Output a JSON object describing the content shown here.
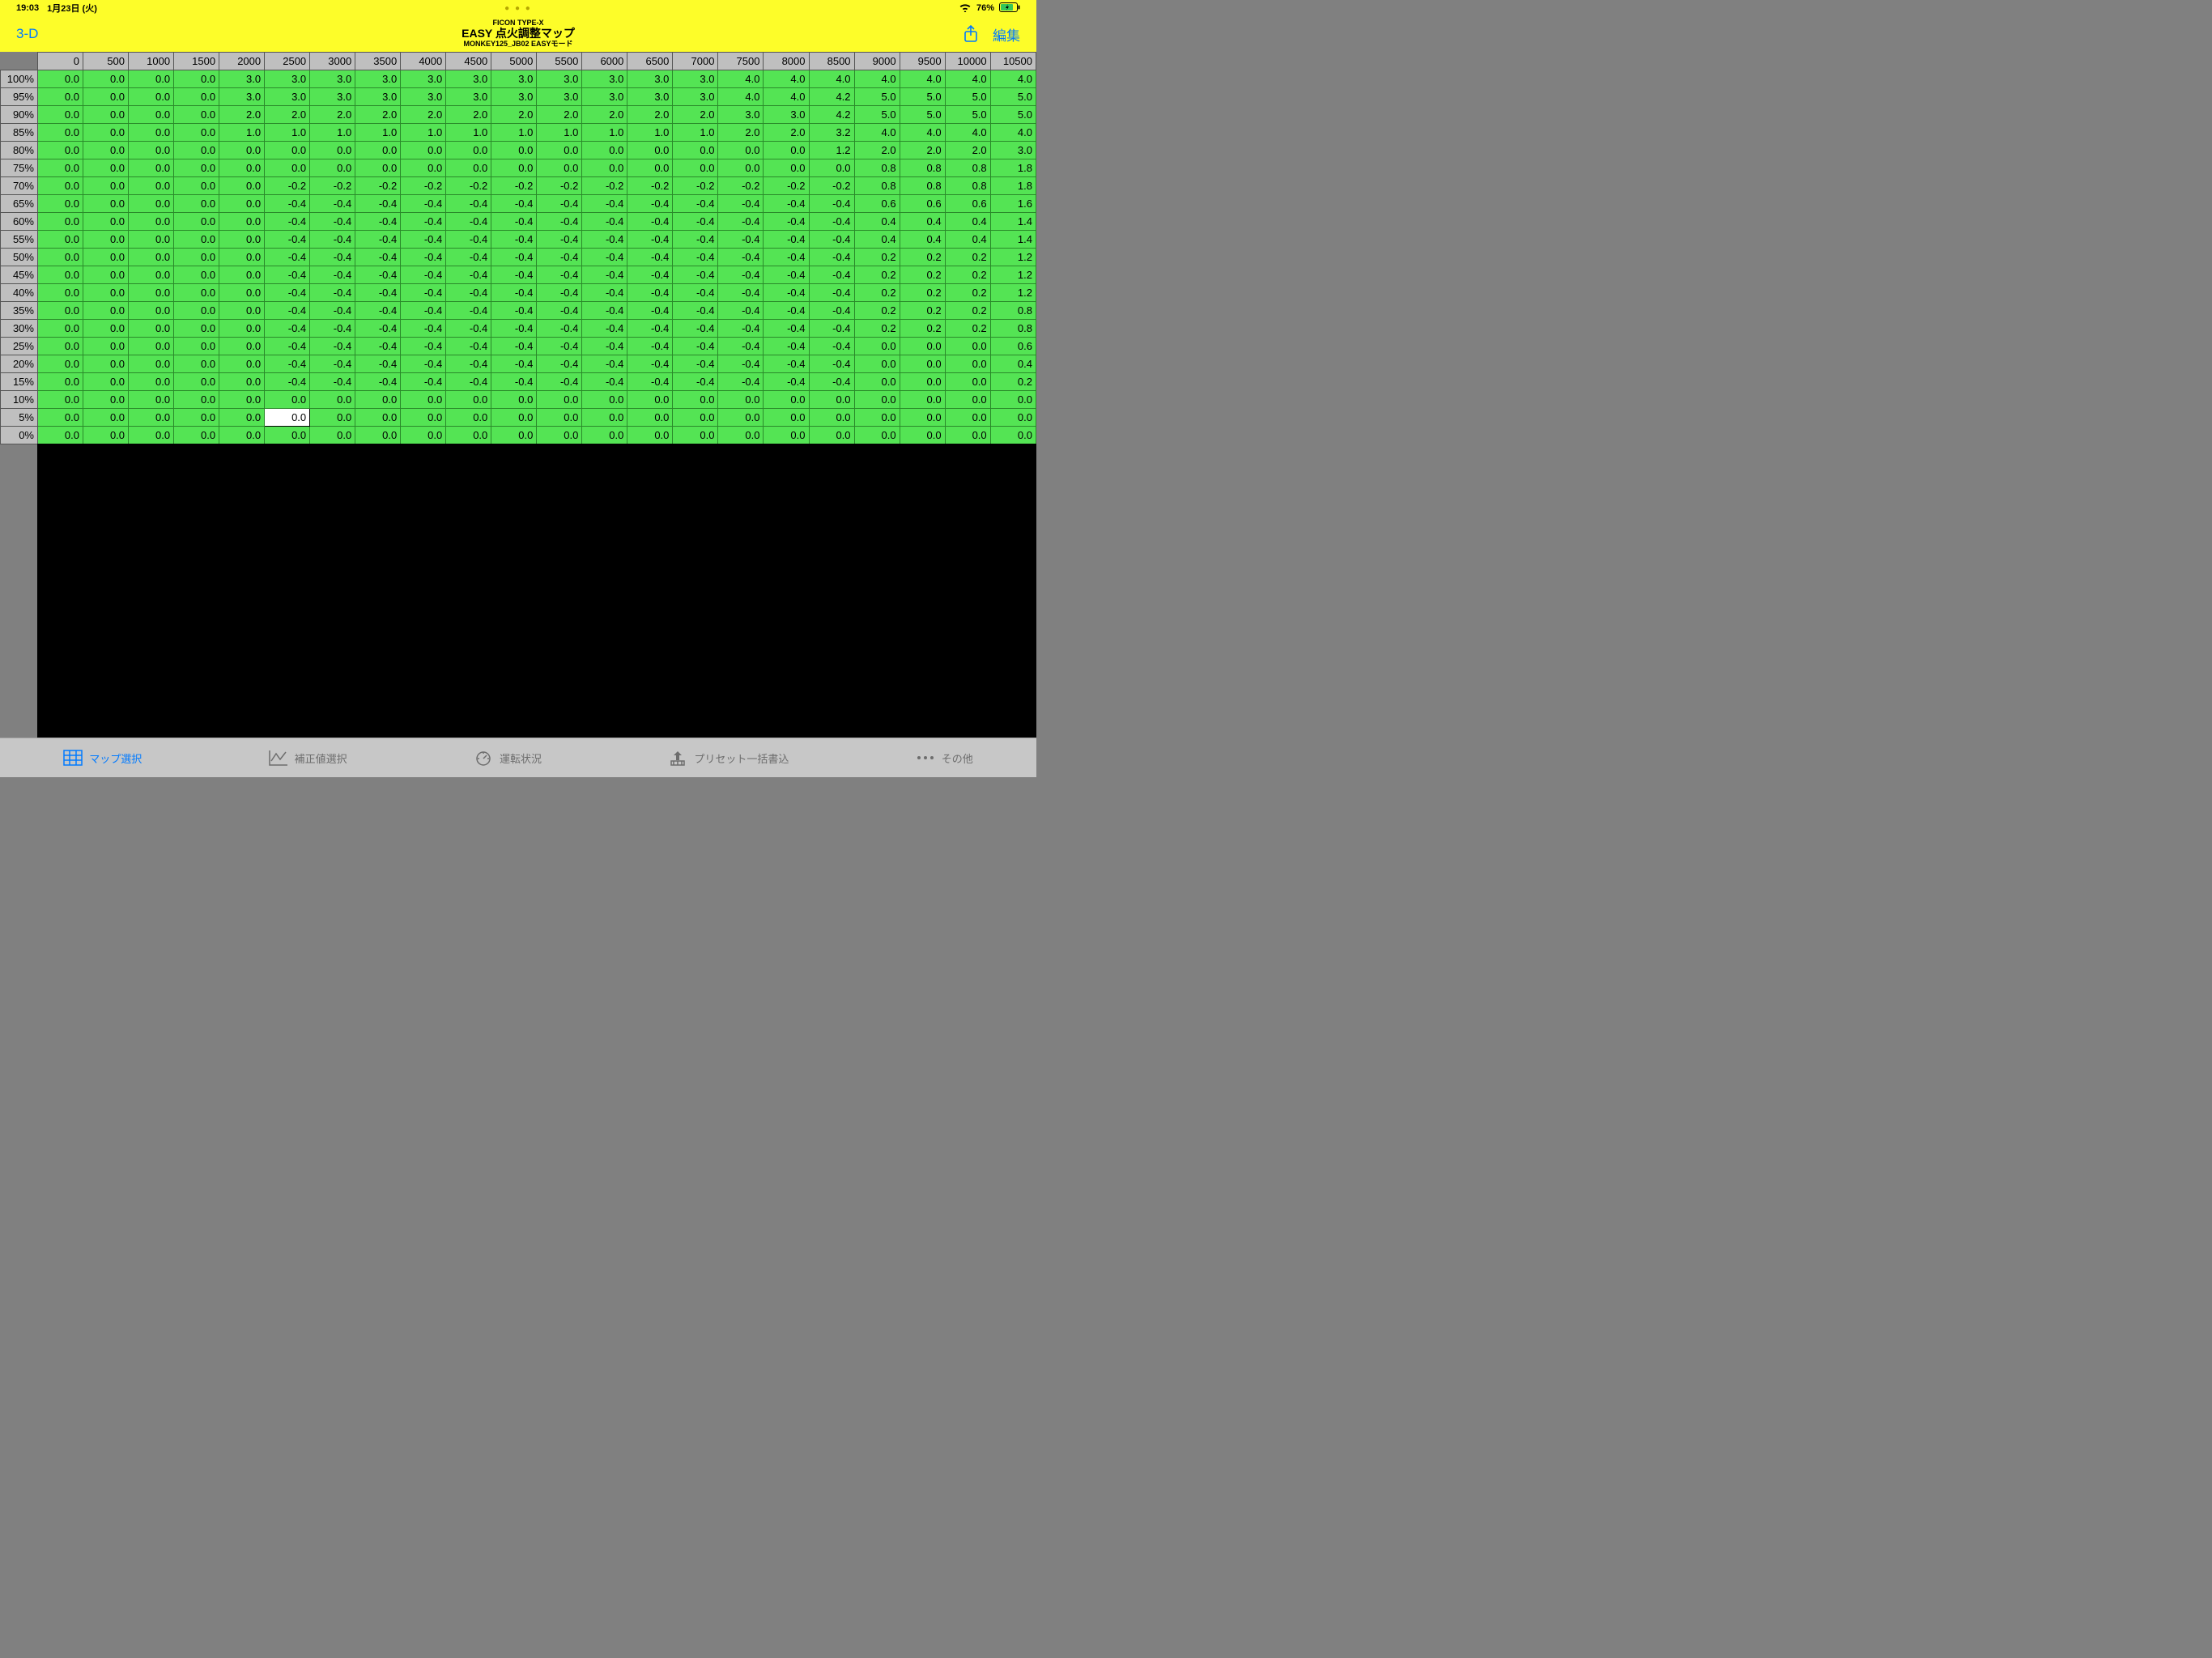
{
  "status": {
    "time": "19:03",
    "date": "1月23日 (火)",
    "battery": "76%"
  },
  "nav": {
    "left_button": "3-D",
    "title_line1": "FICON TYPE-X",
    "title_line2": "EASY 点火調整マップ",
    "title_line3": "MONKEY125_JB02 EASYモード",
    "edit_button": "編集"
  },
  "table": {
    "col_headers": [
      "0",
      "500",
      "1000",
      "1500",
      "2000",
      "2500",
      "3000",
      "3500",
      "4000",
      "4500",
      "5000",
      "5500",
      "6000",
      "6500",
      "7000",
      "7500",
      "8000",
      "8500",
      "9000",
      "9500",
      "10000",
      "10500"
    ],
    "row_headers": [
      "100%",
      "95%",
      "90%",
      "85%",
      "80%",
      "75%",
      "70%",
      "65%",
      "60%",
      "55%",
      "50%",
      "45%",
      "40%",
      "35%",
      "30%",
      "25%",
      "20%",
      "15%",
      "10%",
      "5%",
      "0%"
    ],
    "selected": {
      "row": 19,
      "col": 5
    },
    "rows": [
      [
        "0.0",
        "0.0",
        "0.0",
        "0.0",
        "3.0",
        "3.0",
        "3.0",
        "3.0",
        "3.0",
        "3.0",
        "3.0",
        "3.0",
        "3.0",
        "3.0",
        "3.0",
        "4.0",
        "4.0",
        "4.0",
        "4.0",
        "4.0",
        "4.0",
        "4.0"
      ],
      [
        "0.0",
        "0.0",
        "0.0",
        "0.0",
        "3.0",
        "3.0",
        "3.0",
        "3.0",
        "3.0",
        "3.0",
        "3.0",
        "3.0",
        "3.0",
        "3.0",
        "3.0",
        "4.0",
        "4.0",
        "4.2",
        "5.0",
        "5.0",
        "5.0",
        "5.0"
      ],
      [
        "0.0",
        "0.0",
        "0.0",
        "0.0",
        "2.0",
        "2.0",
        "2.0",
        "2.0",
        "2.0",
        "2.0",
        "2.0",
        "2.0",
        "2.0",
        "2.0",
        "2.0",
        "3.0",
        "3.0",
        "4.2",
        "5.0",
        "5.0",
        "5.0",
        "5.0"
      ],
      [
        "0.0",
        "0.0",
        "0.0",
        "0.0",
        "1.0",
        "1.0",
        "1.0",
        "1.0",
        "1.0",
        "1.0",
        "1.0",
        "1.0",
        "1.0",
        "1.0",
        "1.0",
        "2.0",
        "2.0",
        "3.2",
        "4.0",
        "4.0",
        "4.0",
        "4.0"
      ],
      [
        "0.0",
        "0.0",
        "0.0",
        "0.0",
        "0.0",
        "0.0",
        "0.0",
        "0.0",
        "0.0",
        "0.0",
        "0.0",
        "0.0",
        "0.0",
        "0.0",
        "0.0",
        "0.0",
        "0.0",
        "1.2",
        "2.0",
        "2.0",
        "2.0",
        "3.0"
      ],
      [
        "0.0",
        "0.0",
        "0.0",
        "0.0",
        "0.0",
        "0.0",
        "0.0",
        "0.0",
        "0.0",
        "0.0",
        "0.0",
        "0.0",
        "0.0",
        "0.0",
        "0.0",
        "0.0",
        "0.0",
        "0.0",
        "0.8",
        "0.8",
        "0.8",
        "1.8"
      ],
      [
        "0.0",
        "0.0",
        "0.0",
        "0.0",
        "0.0",
        "-0.2",
        "-0.2",
        "-0.2",
        "-0.2",
        "-0.2",
        "-0.2",
        "-0.2",
        "-0.2",
        "-0.2",
        "-0.2",
        "-0.2",
        "-0.2",
        "-0.2",
        "0.8",
        "0.8",
        "0.8",
        "1.8"
      ],
      [
        "0.0",
        "0.0",
        "0.0",
        "0.0",
        "0.0",
        "-0.4",
        "-0.4",
        "-0.4",
        "-0.4",
        "-0.4",
        "-0.4",
        "-0.4",
        "-0.4",
        "-0.4",
        "-0.4",
        "-0.4",
        "-0.4",
        "-0.4",
        "0.6",
        "0.6",
        "0.6",
        "1.6"
      ],
      [
        "0.0",
        "0.0",
        "0.0",
        "0.0",
        "0.0",
        "-0.4",
        "-0.4",
        "-0.4",
        "-0.4",
        "-0.4",
        "-0.4",
        "-0.4",
        "-0.4",
        "-0.4",
        "-0.4",
        "-0.4",
        "-0.4",
        "-0.4",
        "0.4",
        "0.4",
        "0.4",
        "1.4"
      ],
      [
        "0.0",
        "0.0",
        "0.0",
        "0.0",
        "0.0",
        "-0.4",
        "-0.4",
        "-0.4",
        "-0.4",
        "-0.4",
        "-0.4",
        "-0.4",
        "-0.4",
        "-0.4",
        "-0.4",
        "-0.4",
        "-0.4",
        "-0.4",
        "0.4",
        "0.4",
        "0.4",
        "1.4"
      ],
      [
        "0.0",
        "0.0",
        "0.0",
        "0.0",
        "0.0",
        "-0.4",
        "-0.4",
        "-0.4",
        "-0.4",
        "-0.4",
        "-0.4",
        "-0.4",
        "-0.4",
        "-0.4",
        "-0.4",
        "-0.4",
        "-0.4",
        "-0.4",
        "0.2",
        "0.2",
        "0.2",
        "1.2"
      ],
      [
        "0.0",
        "0.0",
        "0.0",
        "0.0",
        "0.0",
        "-0.4",
        "-0.4",
        "-0.4",
        "-0.4",
        "-0.4",
        "-0.4",
        "-0.4",
        "-0.4",
        "-0.4",
        "-0.4",
        "-0.4",
        "-0.4",
        "-0.4",
        "0.2",
        "0.2",
        "0.2",
        "1.2"
      ],
      [
        "0.0",
        "0.0",
        "0.0",
        "0.0",
        "0.0",
        "-0.4",
        "-0.4",
        "-0.4",
        "-0.4",
        "-0.4",
        "-0.4",
        "-0.4",
        "-0.4",
        "-0.4",
        "-0.4",
        "-0.4",
        "-0.4",
        "-0.4",
        "0.2",
        "0.2",
        "0.2",
        "1.2"
      ],
      [
        "0.0",
        "0.0",
        "0.0",
        "0.0",
        "0.0",
        "-0.4",
        "-0.4",
        "-0.4",
        "-0.4",
        "-0.4",
        "-0.4",
        "-0.4",
        "-0.4",
        "-0.4",
        "-0.4",
        "-0.4",
        "-0.4",
        "-0.4",
        "0.2",
        "0.2",
        "0.2",
        "0.8"
      ],
      [
        "0.0",
        "0.0",
        "0.0",
        "0.0",
        "0.0",
        "-0.4",
        "-0.4",
        "-0.4",
        "-0.4",
        "-0.4",
        "-0.4",
        "-0.4",
        "-0.4",
        "-0.4",
        "-0.4",
        "-0.4",
        "-0.4",
        "-0.4",
        "0.2",
        "0.2",
        "0.2",
        "0.8"
      ],
      [
        "0.0",
        "0.0",
        "0.0",
        "0.0",
        "0.0",
        "-0.4",
        "-0.4",
        "-0.4",
        "-0.4",
        "-0.4",
        "-0.4",
        "-0.4",
        "-0.4",
        "-0.4",
        "-0.4",
        "-0.4",
        "-0.4",
        "-0.4",
        "0.0",
        "0.0",
        "0.0",
        "0.6"
      ],
      [
        "0.0",
        "0.0",
        "0.0",
        "0.0",
        "0.0",
        "-0.4",
        "-0.4",
        "-0.4",
        "-0.4",
        "-0.4",
        "-0.4",
        "-0.4",
        "-0.4",
        "-0.4",
        "-0.4",
        "-0.4",
        "-0.4",
        "-0.4",
        "0.0",
        "0.0",
        "0.0",
        "0.4"
      ],
      [
        "0.0",
        "0.0",
        "0.0",
        "0.0",
        "0.0",
        "-0.4",
        "-0.4",
        "-0.4",
        "-0.4",
        "-0.4",
        "-0.4",
        "-0.4",
        "-0.4",
        "-0.4",
        "-0.4",
        "-0.4",
        "-0.4",
        "-0.4",
        "0.0",
        "0.0",
        "0.0",
        "0.2"
      ],
      [
        "0.0",
        "0.0",
        "0.0",
        "0.0",
        "0.0",
        "0.0",
        "0.0",
        "0.0",
        "0.0",
        "0.0",
        "0.0",
        "0.0",
        "0.0",
        "0.0",
        "0.0",
        "0.0",
        "0.0",
        "0.0",
        "0.0",
        "0.0",
        "0.0",
        "0.0"
      ],
      [
        "0.0",
        "0.0",
        "0.0",
        "0.0",
        "0.0",
        "0.0",
        "0.0",
        "0.0",
        "0.0",
        "0.0",
        "0.0",
        "0.0",
        "0.0",
        "0.0",
        "0.0",
        "0.0",
        "0.0",
        "0.0",
        "0.0",
        "0.0",
        "0.0",
        "0.0"
      ],
      [
        "0.0",
        "0.0",
        "0.0",
        "0.0",
        "0.0",
        "0.0",
        "0.0",
        "0.0",
        "0.0",
        "0.0",
        "0.0",
        "0.0",
        "0.0",
        "0.0",
        "0.0",
        "0.0",
        "0.0",
        "0.0",
        "0.0",
        "0.0",
        "0.0",
        "0.0"
      ]
    ]
  },
  "tabs": {
    "items": [
      {
        "label": "マップ選択",
        "active": true,
        "icon": "grid"
      },
      {
        "label": "補正値選択",
        "active": false,
        "icon": "chart"
      },
      {
        "label": "運転状況",
        "active": false,
        "icon": "gauge"
      },
      {
        "label": "プリセット一括書込",
        "active": false,
        "icon": "upload"
      },
      {
        "label": "その他",
        "active": false,
        "icon": "more"
      }
    ]
  }
}
